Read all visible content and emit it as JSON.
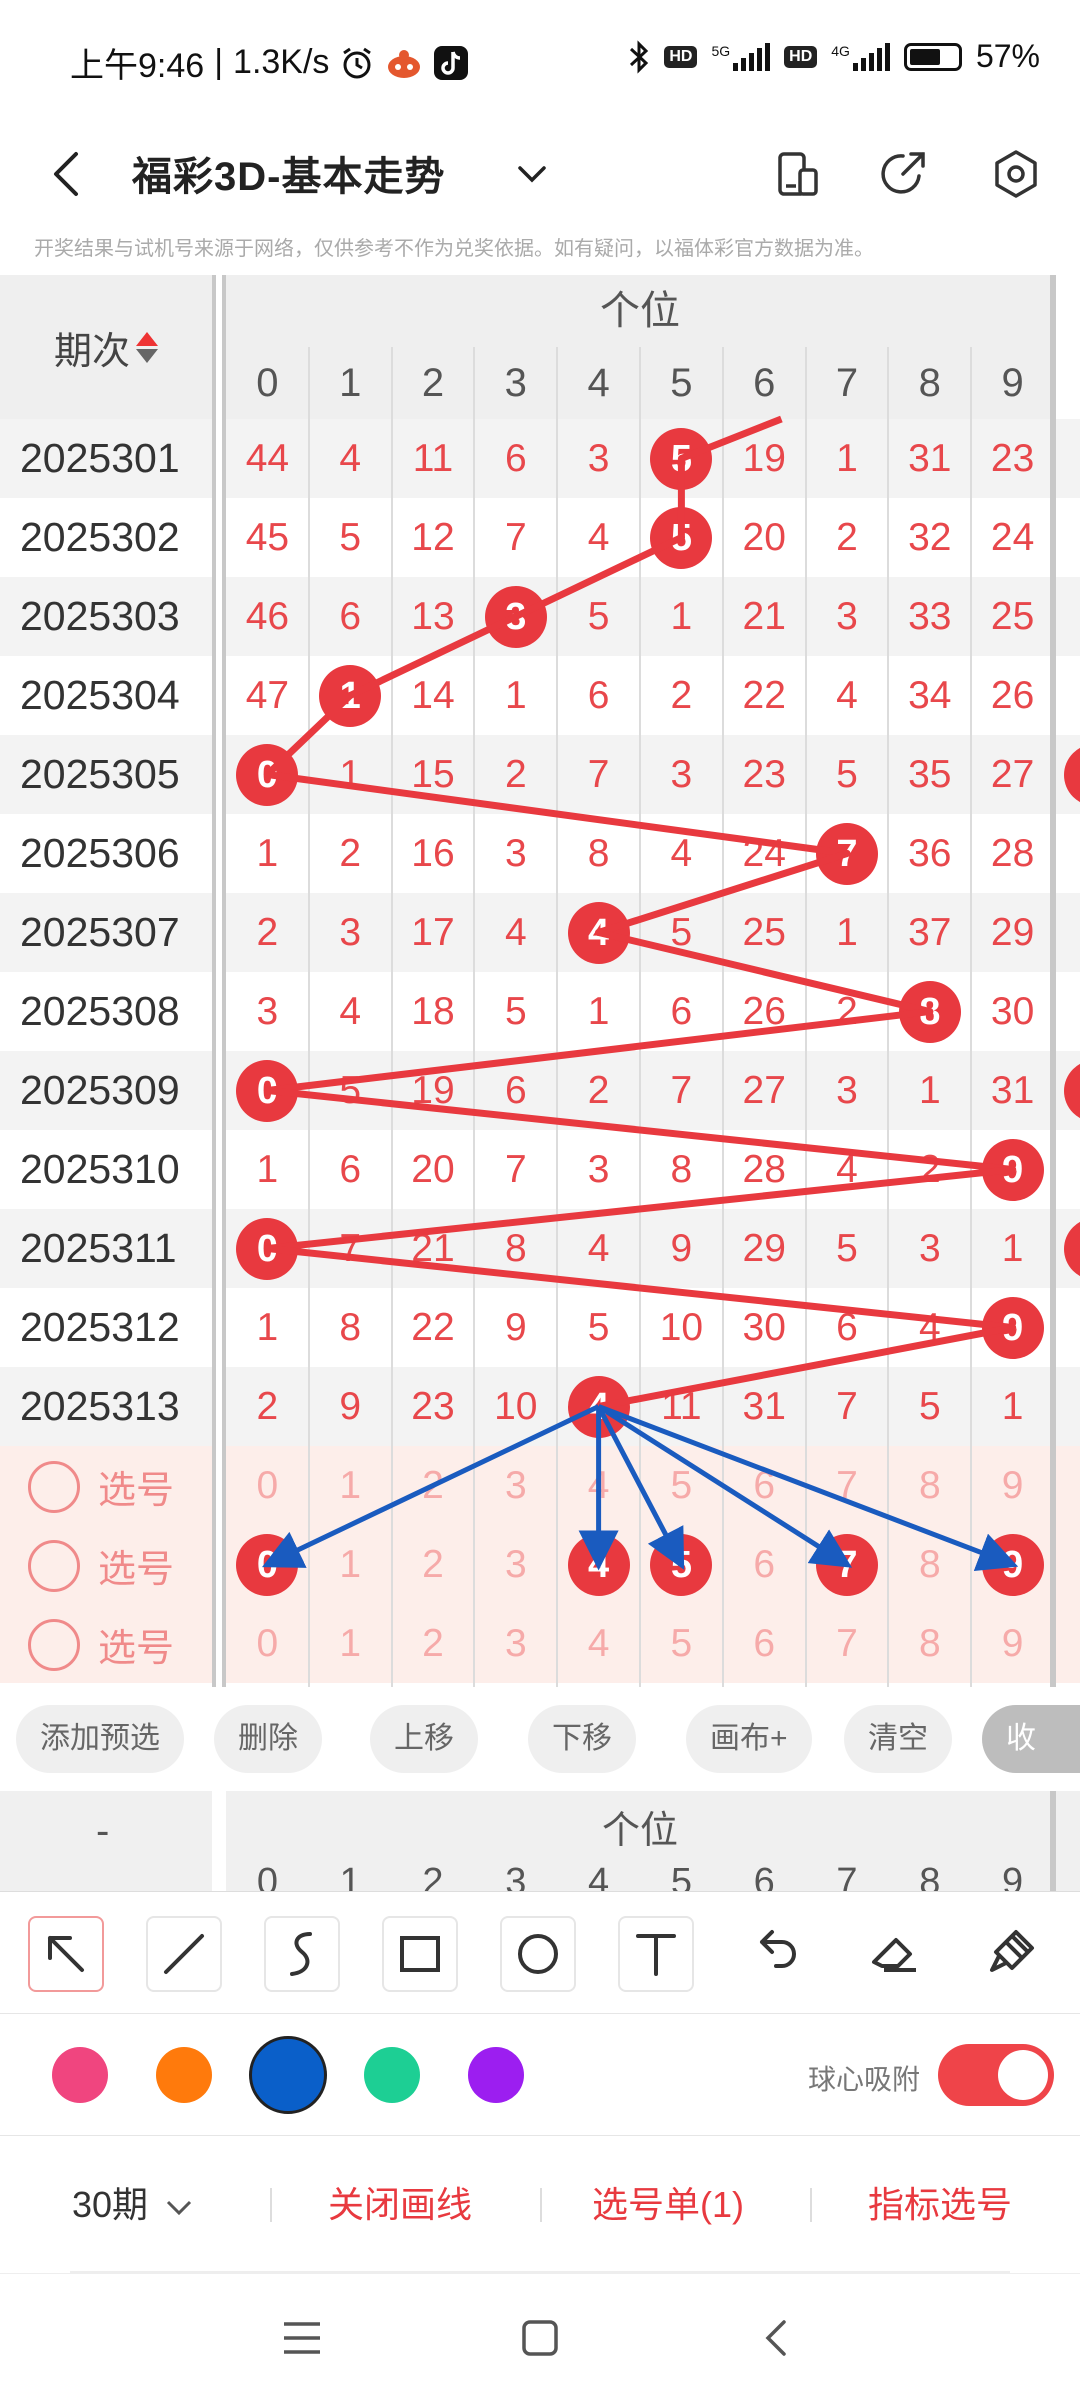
{
  "status": {
    "time": "上午9:46",
    "speed": "1.3K/s",
    "net1": "5G",
    "net2": "4G",
    "hd": "HD",
    "battery": "57%"
  },
  "header": {
    "title": "福彩3D-基本走势"
  },
  "disclaimer": "开奖结果与试机号来源于网络，仅供参考不作为兑奖依据。如有疑问，以福体彩官方数据为准。",
  "table": {
    "period_header": "期次",
    "digit_group": "个位",
    "digits": [
      "0",
      "1",
      "2",
      "3",
      "4",
      "5",
      "6",
      "7",
      "8",
      "9"
    ],
    "rows": [
      {
        "period": "2025301",
        "cells": [
          "44",
          "4",
          "11",
          "6",
          "3",
          "5",
          "19",
          "1",
          "31",
          "23"
        ],
        "hit": 5
      },
      {
        "period": "2025302",
        "cells": [
          "45",
          "5",
          "12",
          "7",
          "4",
          "5",
          "20",
          "2",
          "32",
          "24"
        ],
        "hit": 5
      },
      {
        "period": "2025303",
        "cells": [
          "46",
          "6",
          "13",
          "3",
          "5",
          "1",
          "21",
          "3",
          "33",
          "25"
        ],
        "hit": 3
      },
      {
        "period": "2025304",
        "cells": [
          "47",
          "1",
          "14",
          "1",
          "6",
          "2",
          "22",
          "4",
          "34",
          "26"
        ],
        "hit": 1
      },
      {
        "period": "2025305",
        "cells": [
          "0",
          "1",
          "15",
          "2",
          "7",
          "3",
          "23",
          "5",
          "35",
          "27"
        ],
        "hit": 0
      },
      {
        "period": "2025306",
        "cells": [
          "1",
          "2",
          "16",
          "3",
          "8",
          "4",
          "24",
          "7",
          "36",
          "28"
        ],
        "hit": 7
      },
      {
        "period": "2025307",
        "cells": [
          "2",
          "3",
          "17",
          "4",
          "4",
          "5",
          "25",
          "1",
          "37",
          "29"
        ],
        "hit": 4
      },
      {
        "period": "2025308",
        "cells": [
          "3",
          "4",
          "18",
          "5",
          "1",
          "6",
          "26",
          "2",
          "8",
          "30"
        ],
        "hit": 8
      },
      {
        "period": "2025309",
        "cells": [
          "0",
          "5",
          "19",
          "6",
          "2",
          "7",
          "27",
          "3",
          "1",
          "31"
        ],
        "hit": 0
      },
      {
        "period": "2025310",
        "cells": [
          "1",
          "6",
          "20",
          "7",
          "3",
          "8",
          "28",
          "4",
          "2",
          "9"
        ],
        "hit": 9
      },
      {
        "period": "2025311",
        "cells": [
          "0",
          "7",
          "21",
          "8",
          "4",
          "9",
          "29",
          "5",
          "3",
          "1"
        ],
        "hit": 0
      },
      {
        "period": "2025312",
        "cells": [
          "1",
          "8",
          "22",
          "9",
          "5",
          "10",
          "30",
          "6",
          "4",
          "9"
        ],
        "hit": 9
      },
      {
        "period": "2025313",
        "cells": [
          "2",
          "9",
          "23",
          "10",
          "4",
          "11",
          "31",
          "7",
          "5",
          "1"
        ],
        "hit": 4
      }
    ],
    "pick_label": "选号",
    "pick_rows": [
      {
        "cells": [
          "0",
          "1",
          "2",
          "3",
          "4",
          "5",
          "6",
          "7",
          "8",
          "9"
        ],
        "selected": []
      },
      {
        "cells": [
          "0",
          "1",
          "2",
          "3",
          "4",
          "5",
          "6",
          "7",
          "8",
          "9"
        ],
        "selected": [
          0,
          4,
          5,
          7,
          9
        ]
      },
      {
        "cells": [
          "0",
          "1",
          "2",
          "3",
          "4",
          "5",
          "6",
          "7",
          "8",
          "9"
        ],
        "selected": []
      }
    ]
  },
  "actions": {
    "add": "添加预选",
    "delete": "删除",
    "up": "上移",
    "down": "下移",
    "canvas": "画布+",
    "clear": "清空",
    "collapse": "收起"
  },
  "peek": {
    "period": "-",
    "group": "个位",
    "digits": [
      "0",
      "1",
      "2",
      "3",
      "4",
      "5",
      "6",
      "7",
      "8",
      "9"
    ]
  },
  "tools": [
    "arrow-tool",
    "line-tool",
    "curve-tool",
    "rect-tool",
    "circle-tool",
    "text-tool",
    "undo-tool",
    "eraser-tool",
    "clear-brush-tool"
  ],
  "palette": {
    "colors": [
      "#f0457f",
      "#ff7a0c",
      "#0a5fc9",
      "#1dcf94",
      "#9c1ef0"
    ],
    "selected": 2,
    "snap_label": "球心吸附",
    "snap_on": true
  },
  "bottom": {
    "periods": "30期",
    "close_lines": "关闭画线",
    "pick_list": "选号单(1)",
    "indicator": "指标选号"
  },
  "accent": "#e8393f",
  "arrow_color": "#1a5bbf"
}
